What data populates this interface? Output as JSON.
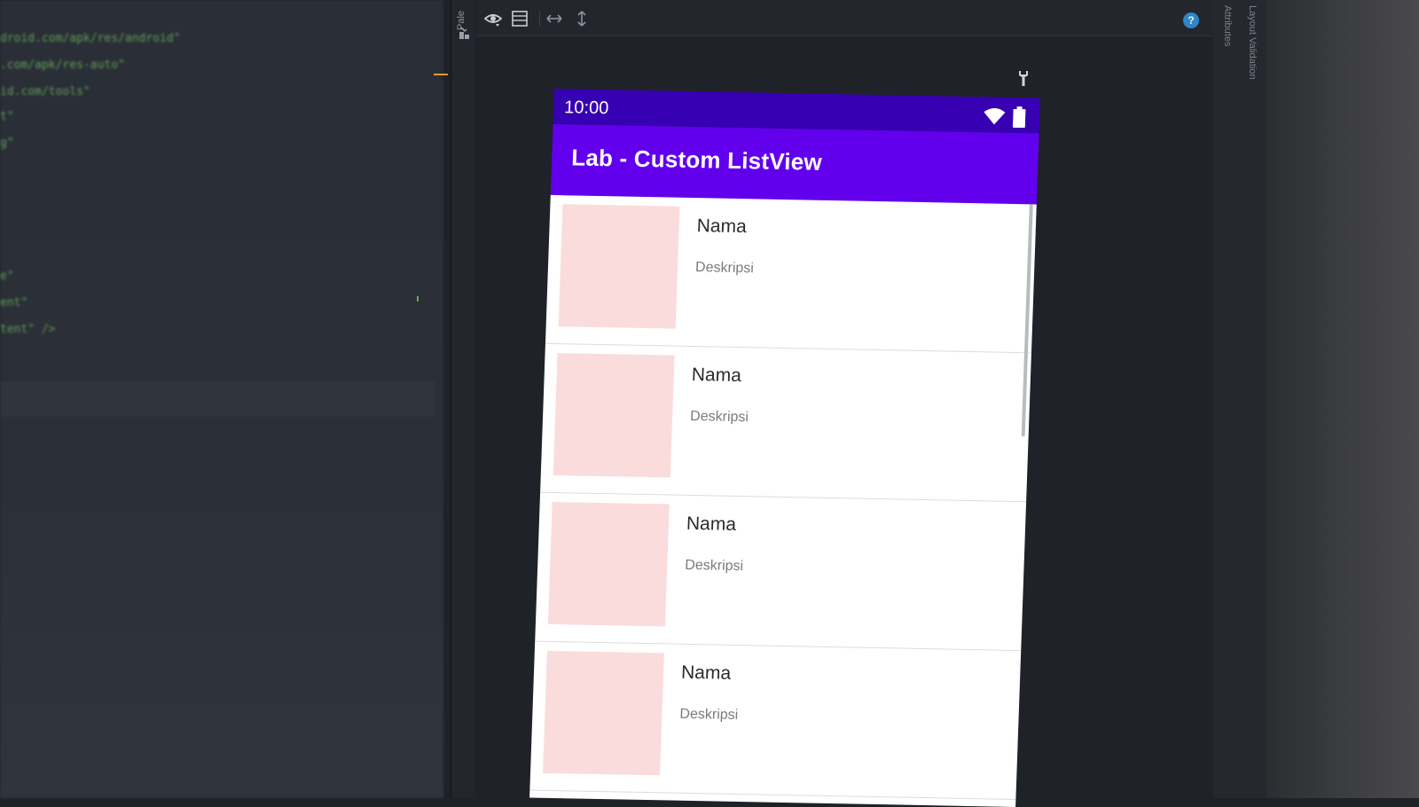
{
  "editor": {
    "code_lines": [
      "droid.com/apk/res/android\"",
      ".com/apk/res-auto\"",
      "id.com/tools\"",
      "t\"",
      "g\"",
      "e\"",
      "ent\"",
      "tent\" />"
    ]
  },
  "palette": {
    "label": "Pale"
  },
  "toolbar": {
    "icons": [
      "eye-icon",
      "blueprint-icon",
      "horizontal-resize-icon",
      "vertical-resize-icon",
      "help-icon"
    ],
    "help_glyph": "?"
  },
  "right_panel": {
    "attributes_label": "Attributes",
    "validation_label": "Layout Validation"
  },
  "phone": {
    "status_time": "10:00",
    "app_title": "Lab - Custom ListView",
    "colors": {
      "status_bar": "#3700b3",
      "app_bar": "#6200ee",
      "thumbnail": "#fadcdc"
    },
    "items": [
      {
        "name": "Nama",
        "description": "Deskripsi"
      },
      {
        "name": "Nama",
        "description": "Deskripsi"
      },
      {
        "name": "Nama",
        "description": "Deskripsi"
      },
      {
        "name": "Nama",
        "description": "Deskripsi"
      }
    ]
  }
}
